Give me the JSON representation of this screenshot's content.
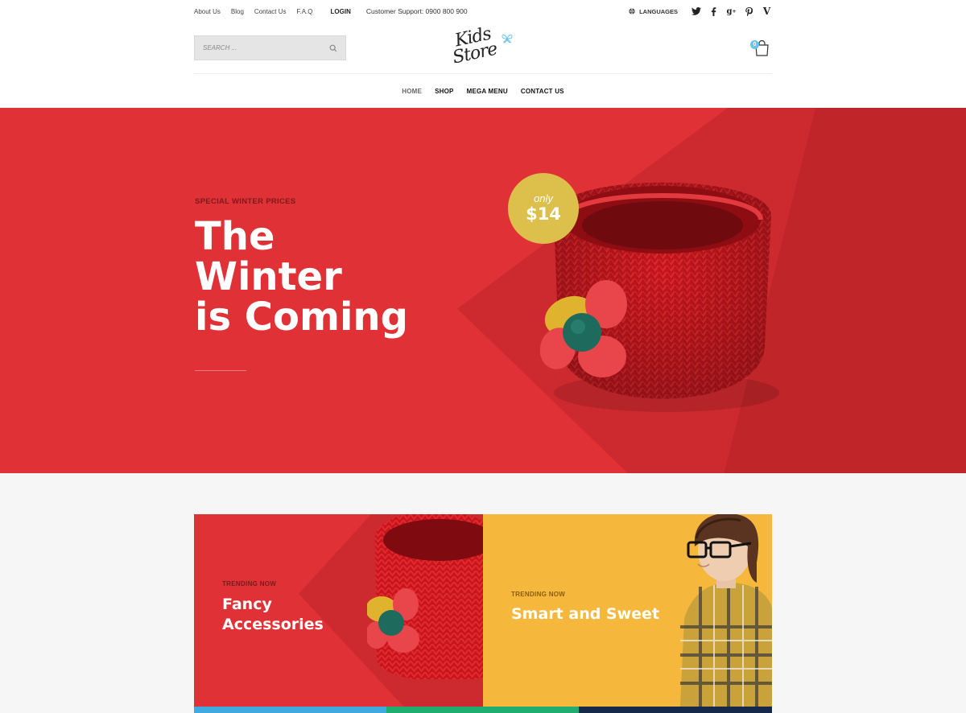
{
  "topbar": {
    "links": [
      "About Us",
      "Blog",
      "Contact Us",
      "F.A.Q"
    ],
    "login": "LOGIN",
    "support": "Customer Support: 0900 800 900",
    "languages": "LANGUAGES",
    "socials": [
      "twitter-icon",
      "facebook-icon",
      "google-plus-icon",
      "pinterest-icon",
      "vimeo-icon"
    ]
  },
  "header": {
    "search_placeholder": "SEARCH ...",
    "logo_line1": "Kids",
    "logo_line2": "Store",
    "cart_count": "0"
  },
  "nav": {
    "items": [
      "HOME",
      "SHOP",
      "MEGA MENU",
      "CONTACT US"
    ],
    "active": "HOME"
  },
  "hero": {
    "eyebrow": "SPECIAL WINTER PRICES",
    "title_lines": [
      "The",
      "Winter",
      "is Coming"
    ],
    "price_prefix": "only",
    "price": "$14"
  },
  "cards": [
    {
      "eyebrow": "TRENDING NOW",
      "title_lines": [
        "Fancy",
        "Accessories"
      ]
    },
    {
      "eyebrow": "TRENDING NOW",
      "title_lines": [
        "Smart and Sweet"
      ]
    }
  ],
  "colors": {
    "hero_red": "#e03236",
    "badge_yellow": "#ddc04b",
    "card_yellow": "#f5b73c",
    "accent_blue": "#6cc3e8"
  }
}
